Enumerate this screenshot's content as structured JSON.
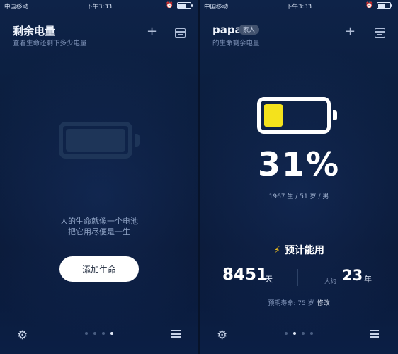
{
  "status": {
    "carrier": "中国移动",
    "time": "下午3:33"
  },
  "left": {
    "title": "剩余电量",
    "subtitle": "查看生命还剩下多少电量",
    "quote_line1": "人的生命就像一个电池",
    "quote_line2": "把它用尽便是一生",
    "add_button": "添加生命"
  },
  "right": {
    "name": "papa",
    "tag": "家人",
    "subtitle": "的生命剩余电量",
    "battery_level": 0.31,
    "battery_color": "#f4e21c",
    "percent": "31%",
    "birth_year": "1967",
    "born_label": "生",
    "age": "51",
    "age_unit": "岁",
    "gender": "男",
    "sep": "/",
    "estimate_title": "预计能用",
    "days": "8451",
    "days_unit": "天",
    "about_label": "大约",
    "years": "23",
    "years_unit": "年",
    "expected_label": "预期寿命: 75 岁",
    "edit_label": "修改"
  },
  "icons": [
    "plus-icon",
    "calendar-icon",
    "gear-icon",
    "menu-icon",
    "bolt-icon"
  ],
  "pager": {
    "count": 4
  }
}
